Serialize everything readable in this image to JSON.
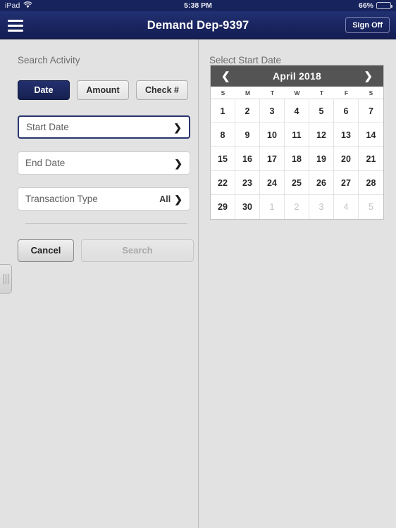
{
  "status_bar": {
    "device": "iPad",
    "wifi_icon": "wifi-icon",
    "time": "5:38 PM",
    "battery_percent": "66%",
    "battery_icon": "battery-icon"
  },
  "nav_bar": {
    "menu_icon": "hamburger-menu-icon",
    "title": "Demand Dep-9397",
    "sign_off_label": "Sign Off"
  },
  "left_pane": {
    "heading": "Search Activity",
    "segmented": [
      {
        "label": "Date",
        "active": true
      },
      {
        "label": "Amount",
        "active": false
      },
      {
        "label": "Check #",
        "active": false
      }
    ],
    "fields": [
      {
        "label": "Start Date",
        "value": "",
        "focused": true,
        "chevron": "chevron-right-icon"
      },
      {
        "label": "End Date",
        "value": "",
        "focused": false,
        "chevron": "chevron-right-icon"
      },
      {
        "label": "Transaction Type",
        "value": "All",
        "focused": false,
        "chevron": "chevron-right-icon"
      }
    ],
    "cancel_label": "Cancel",
    "search_label": "Search",
    "search_disabled": true,
    "drag_handle": "pane-resize-handle"
  },
  "right_pane": {
    "heading": "Select Start Date",
    "calendar": {
      "prev_icon": "chevron-left-icon",
      "next_icon": "chevron-right-icon",
      "title": "April 2018",
      "weekdays": [
        "S",
        "M",
        "T",
        "W",
        "T",
        "F",
        "S"
      ],
      "weeks": [
        [
          {
            "day": "1",
            "muted": false
          },
          {
            "day": "2",
            "muted": false
          },
          {
            "day": "3",
            "muted": false
          },
          {
            "day": "4",
            "muted": false
          },
          {
            "day": "5",
            "muted": false
          },
          {
            "day": "6",
            "muted": false
          },
          {
            "day": "7",
            "muted": false
          }
        ],
        [
          {
            "day": "8",
            "muted": false
          },
          {
            "day": "9",
            "muted": false
          },
          {
            "day": "10",
            "muted": false
          },
          {
            "day": "11",
            "muted": false
          },
          {
            "day": "12",
            "muted": false
          },
          {
            "day": "13",
            "muted": false
          },
          {
            "day": "14",
            "muted": false
          }
        ],
        [
          {
            "day": "15",
            "muted": false
          },
          {
            "day": "16",
            "muted": false
          },
          {
            "day": "17",
            "muted": false
          },
          {
            "day": "18",
            "muted": false
          },
          {
            "day": "19",
            "muted": false
          },
          {
            "day": "20",
            "muted": false
          },
          {
            "day": "21",
            "muted": false
          }
        ],
        [
          {
            "day": "22",
            "muted": false
          },
          {
            "day": "23",
            "muted": false
          },
          {
            "day": "24",
            "muted": false
          },
          {
            "day": "25",
            "muted": false
          },
          {
            "day": "26",
            "muted": false
          },
          {
            "day": "27",
            "muted": false
          },
          {
            "day": "28",
            "muted": false
          }
        ],
        [
          {
            "day": "29",
            "muted": false
          },
          {
            "day": "30",
            "muted": false
          },
          {
            "day": "1",
            "muted": true
          },
          {
            "day": "2",
            "muted": true
          },
          {
            "day": "3",
            "muted": true
          },
          {
            "day": "4",
            "muted": true
          },
          {
            "day": "5",
            "muted": true
          }
        ]
      ]
    }
  },
  "colors": {
    "nav_navy": "#1b2763",
    "status_navy": "#17235c",
    "active_segment": "#22306f",
    "calendar_header_gray": "#545454",
    "page_background": "#e2e2e2"
  }
}
